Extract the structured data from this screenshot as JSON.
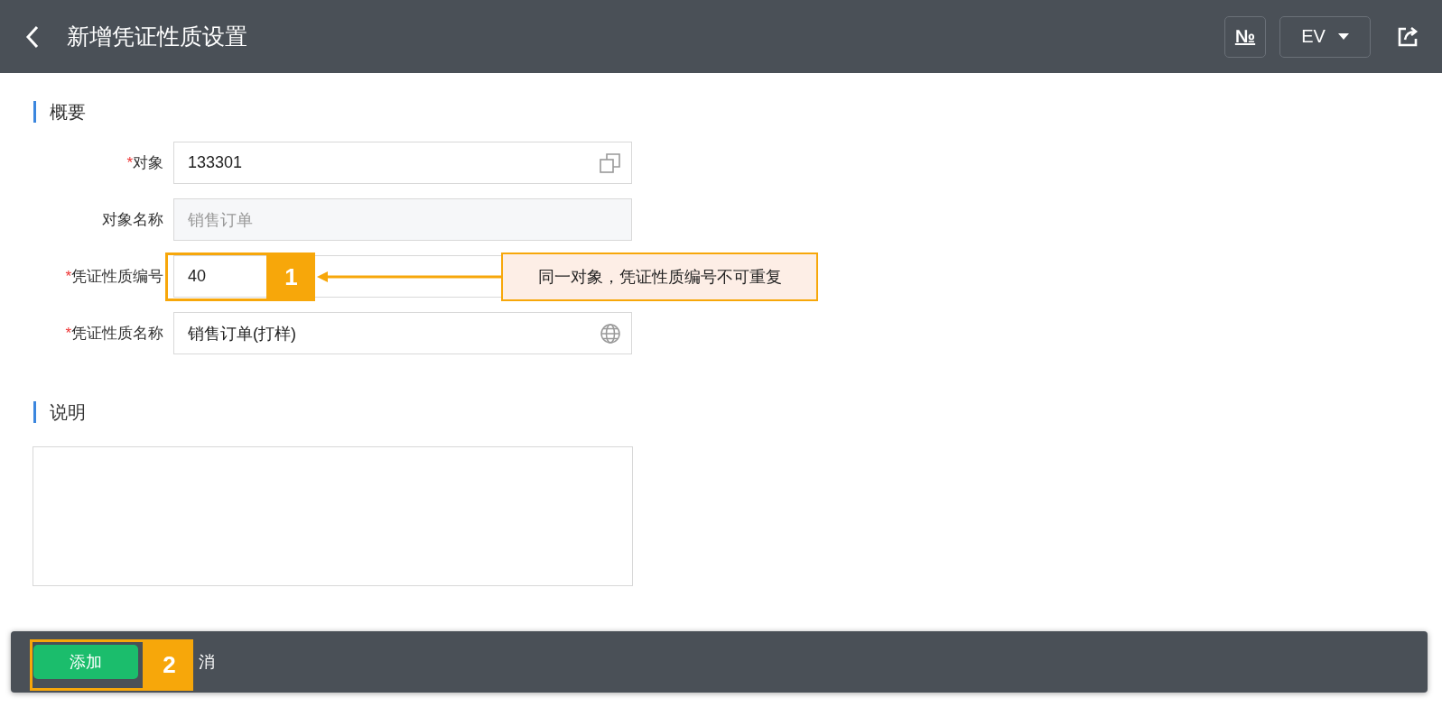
{
  "header": {
    "title": "新增凭证性质设置",
    "toolbar": [
      {
        "kind": "numbering",
        "label": "№"
      },
      {
        "kind": "dropdown",
        "label": "EV"
      },
      {
        "kind": "share"
      }
    ]
  },
  "sections": [
    {
      "title": "概要",
      "fields": [
        {
          "mark": "*",
          "label": "对象",
          "value": "133301",
          "kind": "lookup"
        },
        {
          "label": "对象名称",
          "value": "销售订单",
          "kind": "readonly"
        },
        {
          "mark": "*",
          "label": "凭证性质编号",
          "value": "40",
          "kind": "text"
        },
        {
          "mark": "*",
          "label": "凭证性质名称",
          "value": "销售订单(打样)",
          "kind": "translatable"
        }
      ]
    },
    {
      "title": "说明",
      "fields": [
        {
          "kind": "textarea"
        }
      ]
    }
  ],
  "footer": {
    "buttons": [
      {
        "label": "添加",
        "kind": "primary"
      },
      {
        "label": "消",
        "kind": "plain"
      }
    ]
  },
  "annotations": [
    {
      "number": "1",
      "note": "同一对象，凭证性质编号不可重复"
    },
    {
      "number": "2"
    }
  ]
}
